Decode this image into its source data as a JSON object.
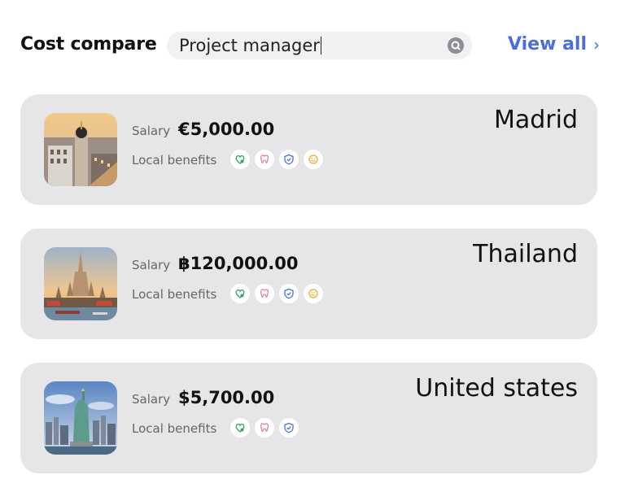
{
  "header": {
    "title": "Cost compare",
    "search_value": "Project manager",
    "view_all_label": "View all",
    "view_all_chevron": "›"
  },
  "labels": {
    "salary": "Salary",
    "local_benefits": "Local benefits"
  },
  "colors": {
    "accent": "#4a6fdc",
    "card_bg": "#e6e6e8",
    "search_bg": "#f1f1f3",
    "health_icon": "#3aa56b",
    "dental_icon": "#e67fa6",
    "insurance_icon": "#4a6fdc",
    "wellness_icon": "#f0b43c"
  },
  "cards": [
    {
      "city": "Madrid",
      "salary": "€5,000.00",
      "photo": "madrid-photo",
      "benefits": [
        "health-icon",
        "dental-icon",
        "insurance-shield-icon",
        "wellness-icon"
      ]
    },
    {
      "city": "Thailand",
      "salary": "฿120,000.00",
      "photo": "thailand-temple-photo",
      "benefits": [
        "health-icon",
        "dental-icon",
        "insurance-shield-icon",
        "wellness-icon"
      ]
    },
    {
      "city": "United states",
      "salary": "$5,700.00",
      "photo": "statue-of-liberty-photo",
      "benefits": [
        "health-icon",
        "dental-icon",
        "insurance-shield-icon"
      ]
    }
  ]
}
